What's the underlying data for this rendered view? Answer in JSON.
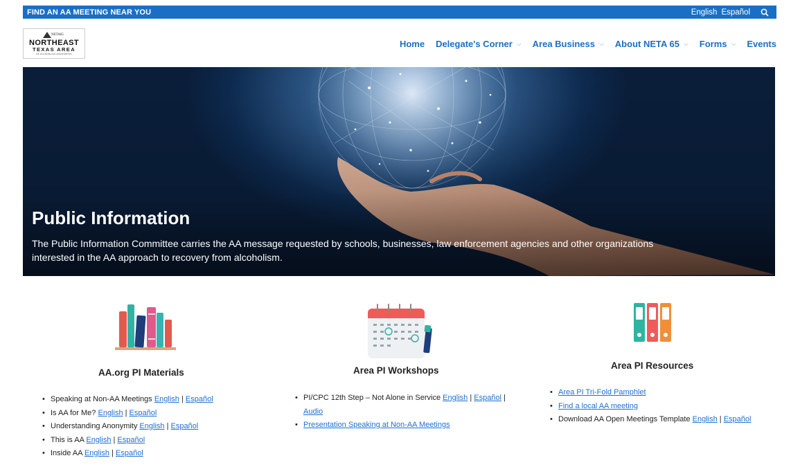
{
  "topbar": {
    "find_label": "FIND AN AA MEETING NEAR YOU",
    "lang_english": "English",
    "lang_espanol": "Español"
  },
  "logo": {
    "small": "NETA65",
    "line1": "NORTHEAST",
    "line2": "TEXAS AREA",
    "line3": "OF ALCOHOLICS ANONYMOUS"
  },
  "nav": {
    "home": "Home",
    "delegates": "Delegate's Corner",
    "area_business": "Area Business",
    "about": "About NETA 65",
    "forms": "Forms",
    "events": "Events"
  },
  "hero": {
    "title": "Public Information",
    "description": "The Public Information Committee carries the AA message requested by schools, businesses, law enforcement agencies and other organizations interested in the AA approach to recovery from alcoholism."
  },
  "columns": {
    "materials": {
      "title": "AA.org PI Materials",
      "items": [
        {
          "text": "Speaking at Non-AA Meetings",
          "link1": "English",
          "sep": "|",
          "link2": "Español"
        },
        {
          "text": "Is AA for Me?",
          "link1": "English",
          "sep": "|",
          "link2": "Español"
        },
        {
          "text": "Understanding Anonymity",
          "link1": "English",
          "sep": "|",
          "link2": "Español"
        },
        {
          "text": "This is AA",
          "link1": "English",
          "sep": "|",
          "link2": "Español"
        },
        {
          "text": "Inside AA",
          "link1": "English",
          "sep": "|",
          "link2": "Español"
        }
      ]
    },
    "workshops": {
      "title": "Area PI Workshops",
      "item1_text": "PI/CPC 12th Step – Not Alone in Service",
      "item1_link1": "English",
      "item1_sep": "|",
      "item1_link2": "Español",
      "item1_sep2": "|",
      "item1_link3": "Audio",
      "item2_link": "Presentation Speaking at Non-AA Meetings"
    },
    "resources": {
      "title": "Area PI Resources",
      "item1_link": "Area PI Tri-Fold Pamphlet",
      "item2_link": "Find a local AA meeting",
      "item3_text": "Download AA Open Meetings Template",
      "item3_link1": "English",
      "item3_sep": "|",
      "item3_link2": "Español"
    }
  },
  "colors": {
    "brand_blue": "#1a6fc4",
    "link_blue": "#1f6fd1"
  }
}
